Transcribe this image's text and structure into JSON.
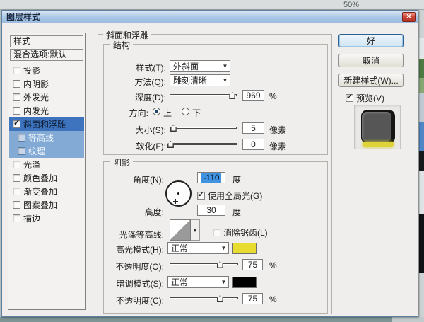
{
  "background": {
    "zoom_level": "50%"
  },
  "dialog": {
    "title": "图层样式"
  },
  "icons": {
    "close": "✕",
    "dropdown_arrow": "▼",
    "check": "✓"
  },
  "colors": {
    "highlight_swatch": "#e8dc30",
    "shadow_swatch": "#000000",
    "selected_item_bg": "#3d74bd",
    "sub_item_bg": "#83aad5",
    "titlebar": "#aac7e6",
    "close_button": "#cf4a3c",
    "angle_selection": "#3f93e0"
  },
  "sidebar": {
    "styles_header": "样式",
    "blending_options": "混合选项:默认",
    "items": [
      {
        "label": "投影",
        "checked": false
      },
      {
        "label": "内阴影",
        "checked": false
      },
      {
        "label": "外发光",
        "checked": false
      },
      {
        "label": "内发光",
        "checked": false
      },
      {
        "label": "斜面和浮雕",
        "checked": true,
        "selected": true
      },
      {
        "label": "等高线",
        "checked": false,
        "sub": true
      },
      {
        "label": "纹理",
        "checked": false,
        "sub": true
      },
      {
        "label": "光泽",
        "checked": false
      },
      {
        "label": "颜色叠加",
        "checked": false
      },
      {
        "label": "渐变叠加",
        "checked": false
      },
      {
        "label": "图案叠加",
        "checked": false
      },
      {
        "label": "描边",
        "checked": false
      }
    ]
  },
  "panel": {
    "title": "斜面和浮雕",
    "structure": {
      "legend": "结构",
      "style_label": "样式(T):",
      "style_value": "外斜面",
      "method_label": "方法(Q):",
      "method_value": "雕刻清晰",
      "depth_label": "深度(D):",
      "depth_value": "969",
      "depth_unit": "%",
      "direction_label": "方向:",
      "direction_up": "上",
      "direction_down": "下",
      "size_label": "大小(S):",
      "size_value": "5",
      "size_unit": "像素",
      "soften_label": "软化(F):",
      "soften_value": "0",
      "soften_unit": "像素"
    },
    "shading": {
      "legend": "阴影",
      "angle_label": "角度(N):",
      "angle_value": "-110",
      "angle_unit": "度",
      "global_light_label": "使用全局光(G)",
      "altitude_label": "高度:",
      "altitude_value": "30",
      "altitude_unit": "度",
      "gloss_contour_label": "光泽等高线:",
      "anti_alias_label": "消除锯齿(L)",
      "highlight_mode_label": "高光模式(H):",
      "highlight_mode_value": "正常",
      "highlight_opacity_label": "不透明度(O):",
      "highlight_opacity_value": "75",
      "highlight_opacity_unit": "%",
      "shadow_mode_label": "暗调模式(S):",
      "shadow_mode_value": "正常",
      "shadow_opacity_label": "不透明度(C):",
      "shadow_opacity_value": "75",
      "shadow_opacity_unit": "%"
    }
  },
  "actions": {
    "ok": "好",
    "cancel": "取消",
    "new_style": "新建样式(W)...",
    "preview": "预览(V)"
  }
}
